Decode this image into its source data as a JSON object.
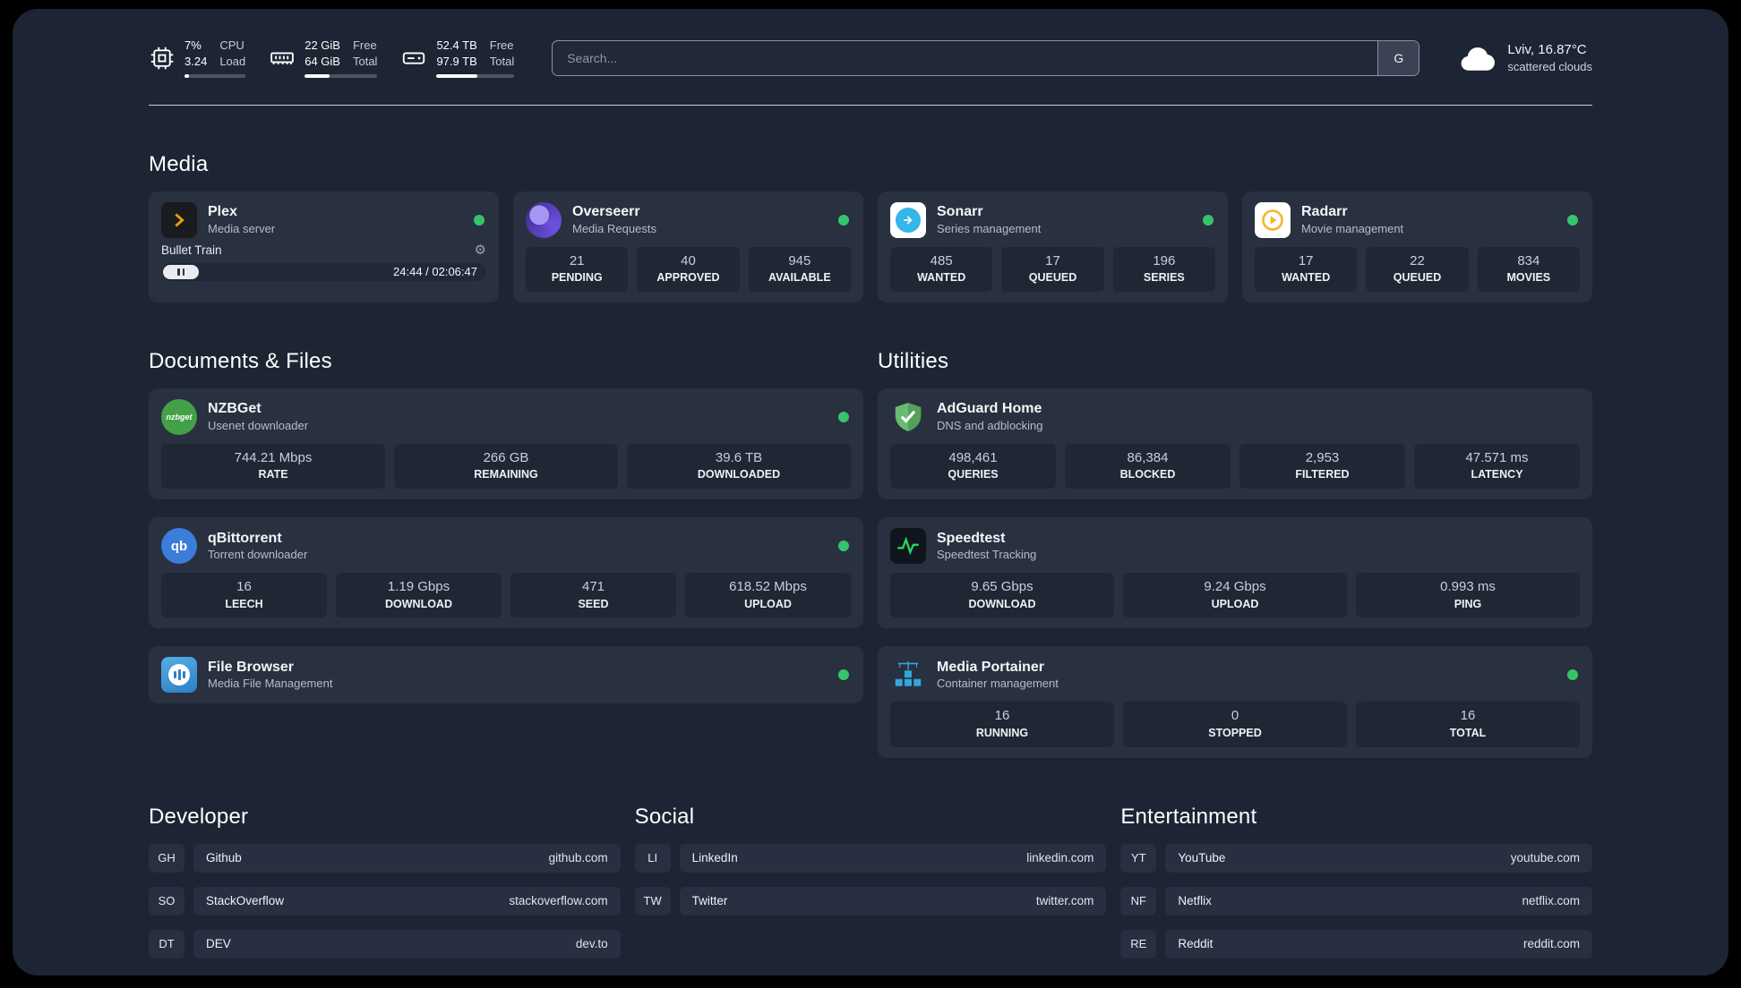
{
  "header": {
    "metrics": [
      {
        "value_top": "7%",
        "value_bottom": "3.24",
        "label_top": "CPU",
        "label_bottom": "Load",
        "bar_percent": 7
      },
      {
        "value_top": "22 GiB",
        "value_bottom": "64 GiB",
        "label_top": "Free",
        "label_bottom": "Total",
        "bar_percent": 34
      },
      {
        "value_top": "52.4 TB",
        "value_bottom": "97.9 TB",
        "label_top": "Free",
        "label_bottom": "Total",
        "bar_percent": 53
      }
    ],
    "search": {
      "placeholder": "Search...",
      "engine_button": "G"
    },
    "weather": {
      "location": "Lviv, 16.87°C",
      "condition": "scattered clouds"
    }
  },
  "sections": {
    "media": {
      "title": "Media",
      "plex": {
        "name": "Plex",
        "subtitle": "Media server",
        "now_playing": {
          "title": "Bullet Train",
          "time": "24:44 / 02:06:47"
        }
      },
      "overseerr": {
        "name": "Overseerr",
        "subtitle": "Media Requests",
        "stats": [
          {
            "value": "21",
            "label": "PENDING"
          },
          {
            "value": "40",
            "label": "APPROVED"
          },
          {
            "value": "945",
            "label": "AVAILABLE"
          }
        ]
      },
      "sonarr": {
        "name": "Sonarr",
        "subtitle": "Series management",
        "stats": [
          {
            "value": "485",
            "label": "WANTED"
          },
          {
            "value": "17",
            "label": "QUEUED"
          },
          {
            "value": "196",
            "label": "SERIES"
          }
        ]
      },
      "radarr": {
        "name": "Radarr",
        "subtitle": "Movie management",
        "stats": [
          {
            "value": "17",
            "label": "WANTED"
          },
          {
            "value": "22",
            "label": "QUEUED"
          },
          {
            "value": "834",
            "label": "MOVIES"
          }
        ]
      }
    },
    "documents": {
      "title": "Documents & Files",
      "nzbget": {
        "name": "NZBGet",
        "subtitle": "Usenet downloader",
        "stats": [
          {
            "value": "744.21 Mbps",
            "label": "RATE"
          },
          {
            "value": "266 GB",
            "label": "REMAINING"
          },
          {
            "value": "39.6 TB",
            "label": "DOWNLOADED"
          }
        ]
      },
      "qbittorrent": {
        "name": "qBittorrent",
        "subtitle": "Torrent downloader",
        "stats": [
          {
            "value": "16",
            "label": "LEECH"
          },
          {
            "value": "1.19 Gbps",
            "label": "DOWNLOAD"
          },
          {
            "value": "471",
            "label": "SEED"
          },
          {
            "value": "618.52 Mbps",
            "label": "UPLOAD"
          }
        ]
      },
      "filebrowser": {
        "name": "File Browser",
        "subtitle": "Media File Management"
      }
    },
    "utilities": {
      "title": "Utilities",
      "adguard": {
        "name": "AdGuard Home",
        "subtitle": "DNS and adblocking",
        "stats": [
          {
            "value": "498,461",
            "label": "QUERIES"
          },
          {
            "value": "86,384",
            "label": "BLOCKED"
          },
          {
            "value": "2,953",
            "label": "FILTERED"
          },
          {
            "value": "47.571 ms",
            "label": "LATENCY"
          }
        ]
      },
      "speedtest": {
        "name": "Speedtest",
        "subtitle": "Speedtest Tracking",
        "stats": [
          {
            "value": "9.65 Gbps",
            "label": "DOWNLOAD"
          },
          {
            "value": "9.24 Gbps",
            "label": "UPLOAD"
          },
          {
            "value": "0.993 ms",
            "label": "PING"
          }
        ]
      },
      "portainer": {
        "name": "Media Portainer",
        "subtitle": "Container management",
        "stats": [
          {
            "value": "16",
            "label": "RUNNING"
          },
          {
            "value": "0",
            "label": "STOPPED"
          },
          {
            "value": "16",
            "label": "TOTAL"
          }
        ]
      }
    },
    "links": {
      "developer": {
        "title": "Developer",
        "items": [
          {
            "abbr": "GH",
            "name": "Github",
            "url": "github.com"
          },
          {
            "abbr": "SO",
            "name": "StackOverflow",
            "url": "stackoverflow.com"
          },
          {
            "abbr": "DT",
            "name": "DEV",
            "url": "dev.to"
          }
        ]
      },
      "social": {
        "title": "Social",
        "items": [
          {
            "abbr": "LI",
            "name": "LinkedIn",
            "url": "linkedin.com"
          },
          {
            "abbr": "TW",
            "name": "Twitter",
            "url": "twitter.com"
          }
        ]
      },
      "entertainment": {
        "title": "Entertainment",
        "items": [
          {
            "abbr": "YT",
            "name": "YouTube",
            "url": "youtube.com"
          },
          {
            "abbr": "NF",
            "name": "Netflix",
            "url": "netflix.com"
          },
          {
            "abbr": "RE",
            "name": "Reddit",
            "url": "reddit.com"
          }
        ]
      }
    }
  }
}
